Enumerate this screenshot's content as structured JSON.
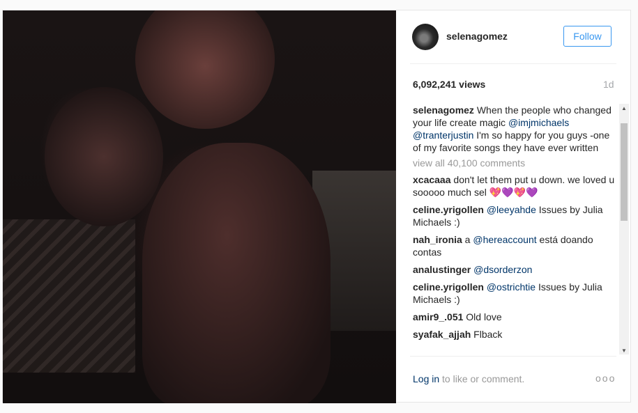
{
  "post": {
    "username": "selenagomez",
    "follow_label": "Follow",
    "views": "6,092,241 views",
    "time_ago": "1d",
    "caption": {
      "user": "selenagomez",
      "text_1": " When the people who changed your life create magic ",
      "mention_1": "@imjmichaels",
      "mention_2": "@tranterjustin",
      "text_2": " I'm so happy for you guys -one of my favorite songs they have ever written"
    },
    "view_all": "view all 40,100 comments"
  },
  "comments": [
    {
      "user": "xcacaaa",
      "pre": " don't let them put u down. we loved u sooooo much sel 💖💜💖💜",
      "mention": "",
      "post": ""
    },
    {
      "user": "celine.yrigollen",
      "pre": " ",
      "mention": "@leeyahde",
      "post": " Issues by Julia Michaels :)"
    },
    {
      "user": "nah_ironia",
      "pre": " a ",
      "mention": "@hereaccount",
      "post": " está doando contas"
    },
    {
      "user": "analustinger",
      "pre": " ",
      "mention": "@dsorderzon",
      "post": ""
    },
    {
      "user": "celine.yrigollen",
      "pre": " ",
      "mention": "@ostrichtie",
      "post": " Issues by Julia Michaels :)"
    },
    {
      "user": "amir9_.051",
      "pre": " Old love",
      "mention": "",
      "post": ""
    },
    {
      "user": "syafak_ajjah",
      "pre": " Flback",
      "mention": "",
      "post": ""
    }
  ],
  "footer": {
    "login_link": "Log in",
    "login_rest": " to like or comment.",
    "more_label": "ooo"
  },
  "icons": {
    "scroll_up": "▲",
    "scroll_down": "▼"
  },
  "colors": {
    "accent": "#3897f0",
    "mention": "#003569",
    "muted": "#999999"
  }
}
